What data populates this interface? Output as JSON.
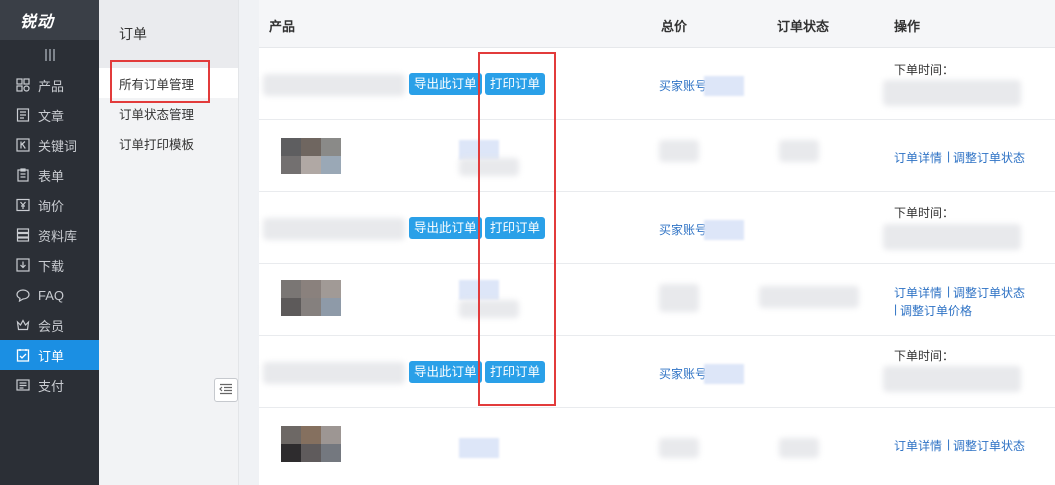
{
  "brand": {
    "logo": "锐动"
  },
  "nav": {
    "items": [
      {
        "label": "产品",
        "icon": "grid-icon"
      },
      {
        "label": "文章",
        "icon": "document-icon"
      },
      {
        "label": "关键词",
        "icon": "k-badge-icon"
      },
      {
        "label": "表单",
        "icon": "clipboard-icon"
      },
      {
        "label": "询价",
        "icon": "yen-icon"
      },
      {
        "label": "资料库",
        "icon": "database-icon"
      },
      {
        "label": "下载",
        "icon": "download-icon"
      },
      {
        "label": "FAQ",
        "icon": "chat-icon"
      },
      {
        "label": "会员",
        "icon": "crown-icon"
      },
      {
        "label": "订单",
        "icon": "checklist-icon",
        "active": true
      },
      {
        "label": "支付",
        "icon": "wallet-icon"
      }
    ]
  },
  "subnav": {
    "title": "订单",
    "items": [
      "所有订单管理",
      "订单状态管理",
      "订单打印模板"
    ]
  },
  "table": {
    "headers": {
      "product": "产品",
      "total": "总价",
      "status": "订单状态",
      "action": "操作"
    },
    "export_label": "导出此订单",
    "print_label": "打印订单",
    "buyer_label": "买家账号",
    "order_time_label": "下单时间：",
    "detail_link": "订单详情",
    "sep": "|",
    "change_status_link": "调整订单状态",
    "change_price_link": "调整订单价格"
  },
  "colors": {
    "accent": "#1b8fe3",
    "button": "#2aa0e8",
    "highlight": "#e23b3b",
    "nav_bg": "#2b2f36"
  }
}
